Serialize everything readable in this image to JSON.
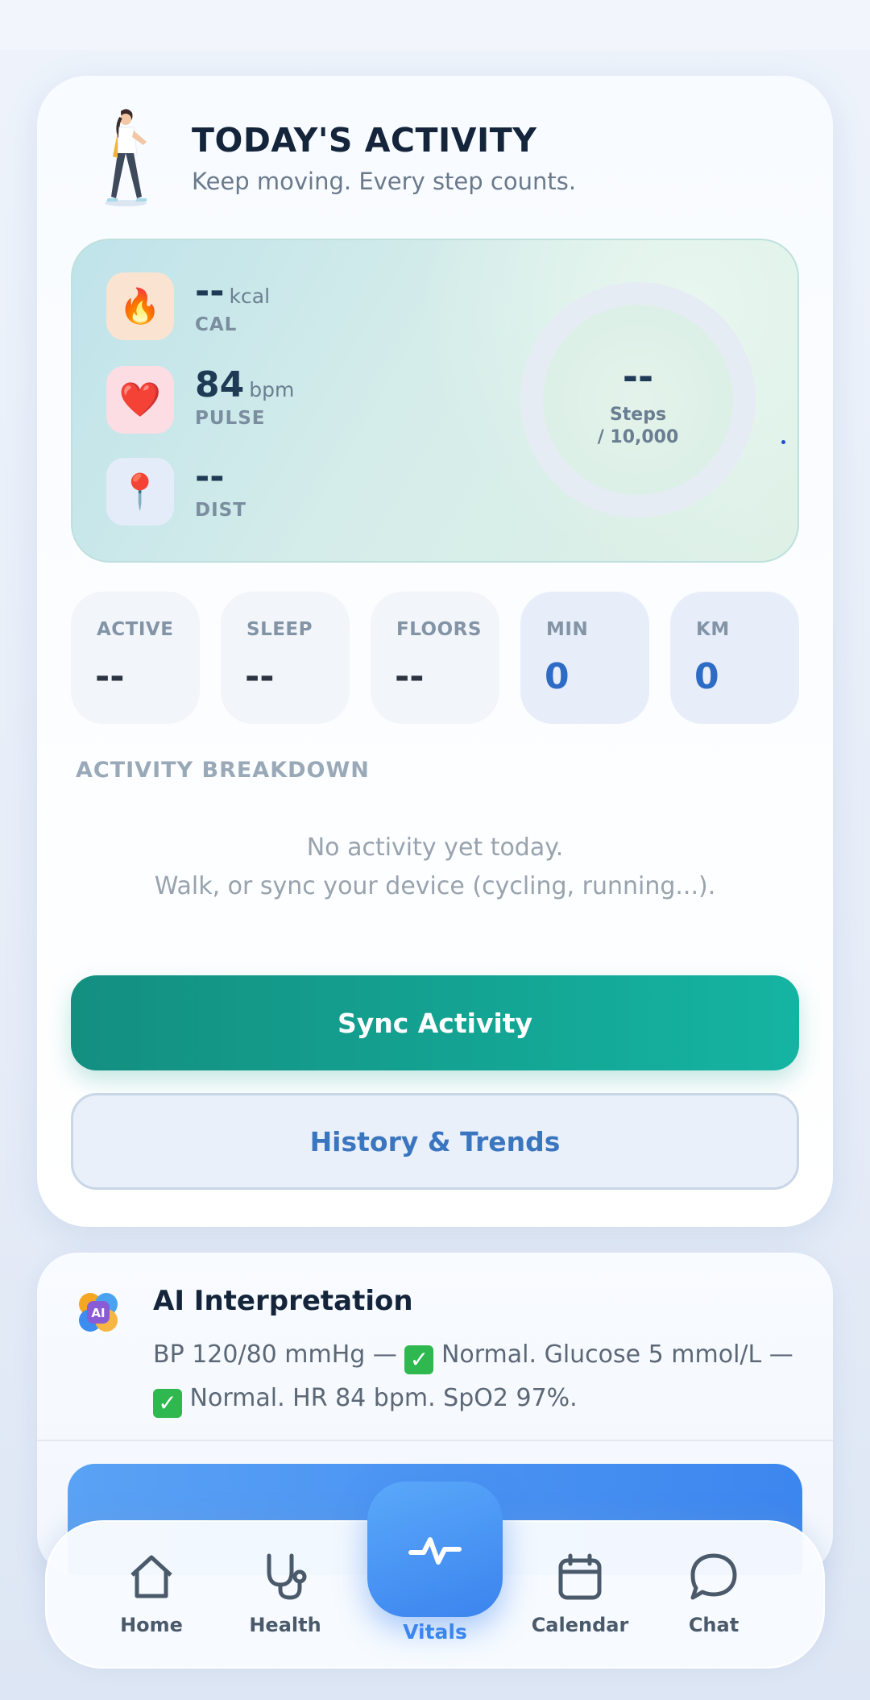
{
  "activity": {
    "title": "TODAY'S ACTIVITY",
    "subtitle": "Keep moving. Every step counts.",
    "stats": [
      {
        "icon": "fire-icon",
        "value": "--",
        "unit": "kcal",
        "label": "CAL",
        "bg": "#fbe3d2"
      },
      {
        "icon": "heart-icon",
        "value": "84",
        "unit": "bpm",
        "label": "PULSE",
        "bg": "#fbdde3"
      },
      {
        "icon": "pin-icon",
        "value": "--",
        "unit": "",
        "label": "DIST",
        "bg": "#e3ecf8"
      }
    ],
    "steps": {
      "value": "--",
      "label": "Steps",
      "goal": "/ 10,000",
      "progress": 0
    },
    "tiles": [
      {
        "label": "ACTIVE",
        "value": "--"
      },
      {
        "label": "SLEEP",
        "value": "--"
      },
      {
        "label": "FLOORS",
        "value": "--"
      },
      {
        "label": "MIN",
        "value": "0"
      },
      {
        "label": "KM",
        "value": "0"
      }
    ],
    "breakdown_title": "ACTIVITY BREAKDOWN",
    "empty_line1": "No activity yet today.",
    "empty_line2": "Walk, or sync your device (cycling, running...).",
    "sync_label": "Sync Activity",
    "history_label": "History & Trends"
  },
  "ai": {
    "icon_text": "AI",
    "title": "AI Interpretation",
    "text_part1": "BP 120/80 mmHg — ",
    "text_part2": " Normal. Glucose 5 mmol/L — ",
    "text_part3": " Normal. HR 84 bpm. SpO2 97%."
  },
  "nav": {
    "items": [
      {
        "label": "Home",
        "icon": "home-icon"
      },
      {
        "label": "Health",
        "icon": "stethoscope-icon"
      },
      {
        "label": "Vitals",
        "icon": "pulse-icon"
      },
      {
        "label": "Calendar",
        "icon": "calendar-icon"
      },
      {
        "label": "Chat",
        "icon": "chat-icon"
      }
    ]
  },
  "colors": {
    "accent_teal": "#15b4a2",
    "accent_blue": "#3b86ee",
    "history_text": "#3a76c0"
  }
}
